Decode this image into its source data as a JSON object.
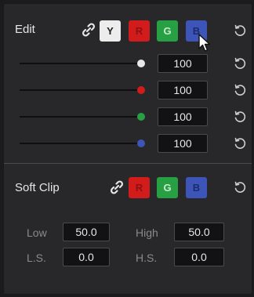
{
  "edit": {
    "title": "Edit",
    "chips": {
      "y": "Y",
      "r": "R",
      "g": "G",
      "b": "B"
    },
    "sliders": [
      {
        "channel": "Y",
        "color": "#e8e8e8",
        "value": "100"
      },
      {
        "channel": "R",
        "color": "#d21c1c",
        "value": "100"
      },
      {
        "channel": "G",
        "color": "#27a043",
        "value": "100"
      },
      {
        "channel": "B",
        "color": "#3d55b8",
        "value": "100"
      }
    ]
  },
  "soft_clip": {
    "title": "Soft Clip",
    "chips": {
      "r": "R",
      "g": "G",
      "b": "B"
    },
    "low_label": "Low",
    "low_value": "50.0",
    "high_label": "High",
    "high_value": "50.0",
    "ls_label": "L.S.",
    "ls_value": "0.0",
    "hs_label": "H.S.",
    "hs_value": "0.0"
  },
  "icons": {
    "link": "link-icon",
    "reset": "reset-icon",
    "cursor": "mouse-pointer-icon"
  }
}
